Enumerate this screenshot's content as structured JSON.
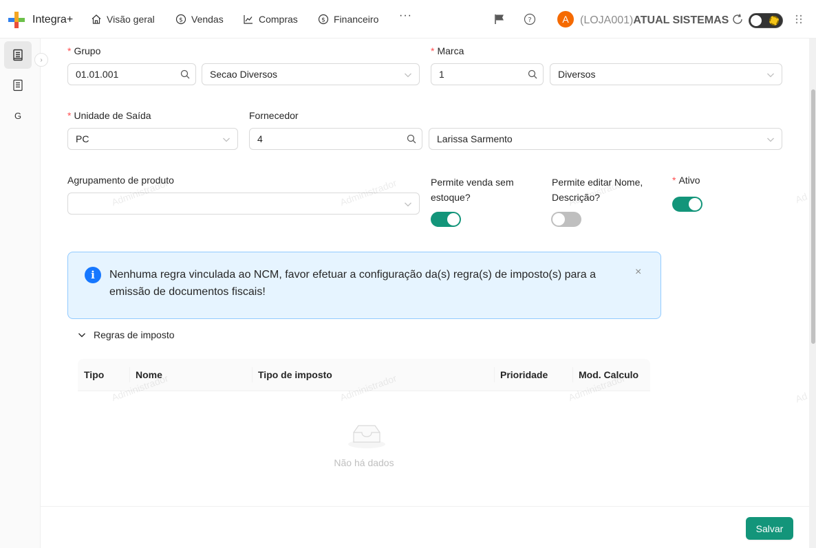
{
  "app": {
    "brand": "Integra+"
  },
  "nav": [
    {
      "label": "Visão geral",
      "icon": "home-icon"
    },
    {
      "label": "Vendas",
      "icon": "dollar-circle-icon"
    },
    {
      "label": "Compras",
      "icon": "line-chart-icon"
    },
    {
      "label": "Financeiro",
      "icon": "dollar-circle-icon"
    }
  ],
  "nav_more": "···",
  "user": {
    "avatar_letter": "A",
    "store_code": "(LOJA001)",
    "store_name": "ATUAL SISTEMAS"
  },
  "sidebar": {
    "items": [
      {
        "icon": "document-icon"
      },
      {
        "icon": "document-icon"
      },
      {
        "label": "G"
      }
    ]
  },
  "form": {
    "grupo": {
      "label": "Grupo",
      "code": "01.01.001",
      "name": "Secao Diversos"
    },
    "marca": {
      "label": "Marca",
      "code": "1",
      "name": "Diversos"
    },
    "unidade": {
      "label": "Unidade de Saída",
      "value": "PC"
    },
    "fornecedor": {
      "label": "Fornecedor",
      "code": "4",
      "name": "Larissa Sarmento"
    },
    "agrupamento": {
      "label": "Agrupamento de produto",
      "value": ""
    },
    "permite_venda": {
      "label_line1": "Permite venda sem",
      "label_line2": "estoque?",
      "on": true
    },
    "permite_editar": {
      "label_line1": "Permite editar Nome,",
      "label_line2": "Descrição?",
      "on": false
    },
    "ativo": {
      "label": "Ativo",
      "on": true
    },
    "required_mark": "*"
  },
  "alert": {
    "message": "Nenhuma regra vinculada ao NCM, favor efetuar a configuração da(s) regra(s) de imposto(s) para a emissão de documentos fiscais!",
    "close": "×"
  },
  "section": {
    "title": "Regras de imposto"
  },
  "table": {
    "columns": [
      "Tipo",
      "Nome",
      "Tipo de imposto",
      "Prioridade",
      "Mod. Calculo"
    ],
    "empty_text": "Não há dados"
  },
  "footer": {
    "save_label": "Salvar"
  },
  "watermark": "Administrador",
  "watermark_partial": "Ad",
  "colors": {
    "primary": "#13957a",
    "info": "#1677ff",
    "avatar": "#f56a00"
  }
}
